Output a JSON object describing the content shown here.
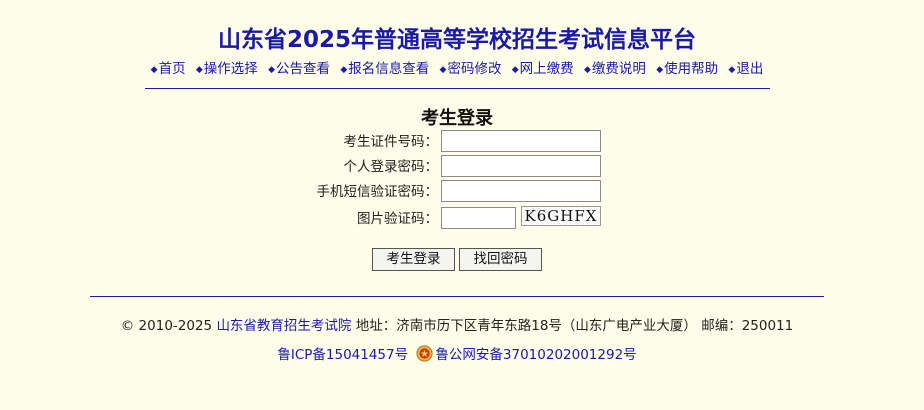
{
  "header": {
    "title": "山东省2025年普通高等学校招生考试信息平台"
  },
  "nav": {
    "bullet": "◆",
    "items": [
      "首页",
      "操作选择",
      "公告查看",
      "报名信息查看",
      "密码修改",
      "网上缴费",
      "缴费说明",
      "使用帮助",
      "退出"
    ]
  },
  "form": {
    "title": "考生登录",
    "id_label": "考生证件号码：",
    "id_value": "",
    "password_label": "个人登录密码：",
    "password_value": "",
    "sms_label": "手机短信验证密码：",
    "sms_value": "",
    "captcha_label": "图片验证码：",
    "captcha_value": "",
    "captcha_image_text": "K6GHFX",
    "login_button": "考生登录",
    "find_password_button": "找回密码"
  },
  "footer": {
    "copyright": "© 2010-2025 ",
    "org_link": "山东省教育招生考试院",
    "address": " 地址：济南市历下区青年东路18号（山东广电产业大厦） 邮编：250011",
    "icp": "鲁ICP备15041457号",
    "police": "鲁公网安备37010202001292号"
  },
  "colors": {
    "background": "#fdfde9",
    "link": "#1a1aa6"
  }
}
